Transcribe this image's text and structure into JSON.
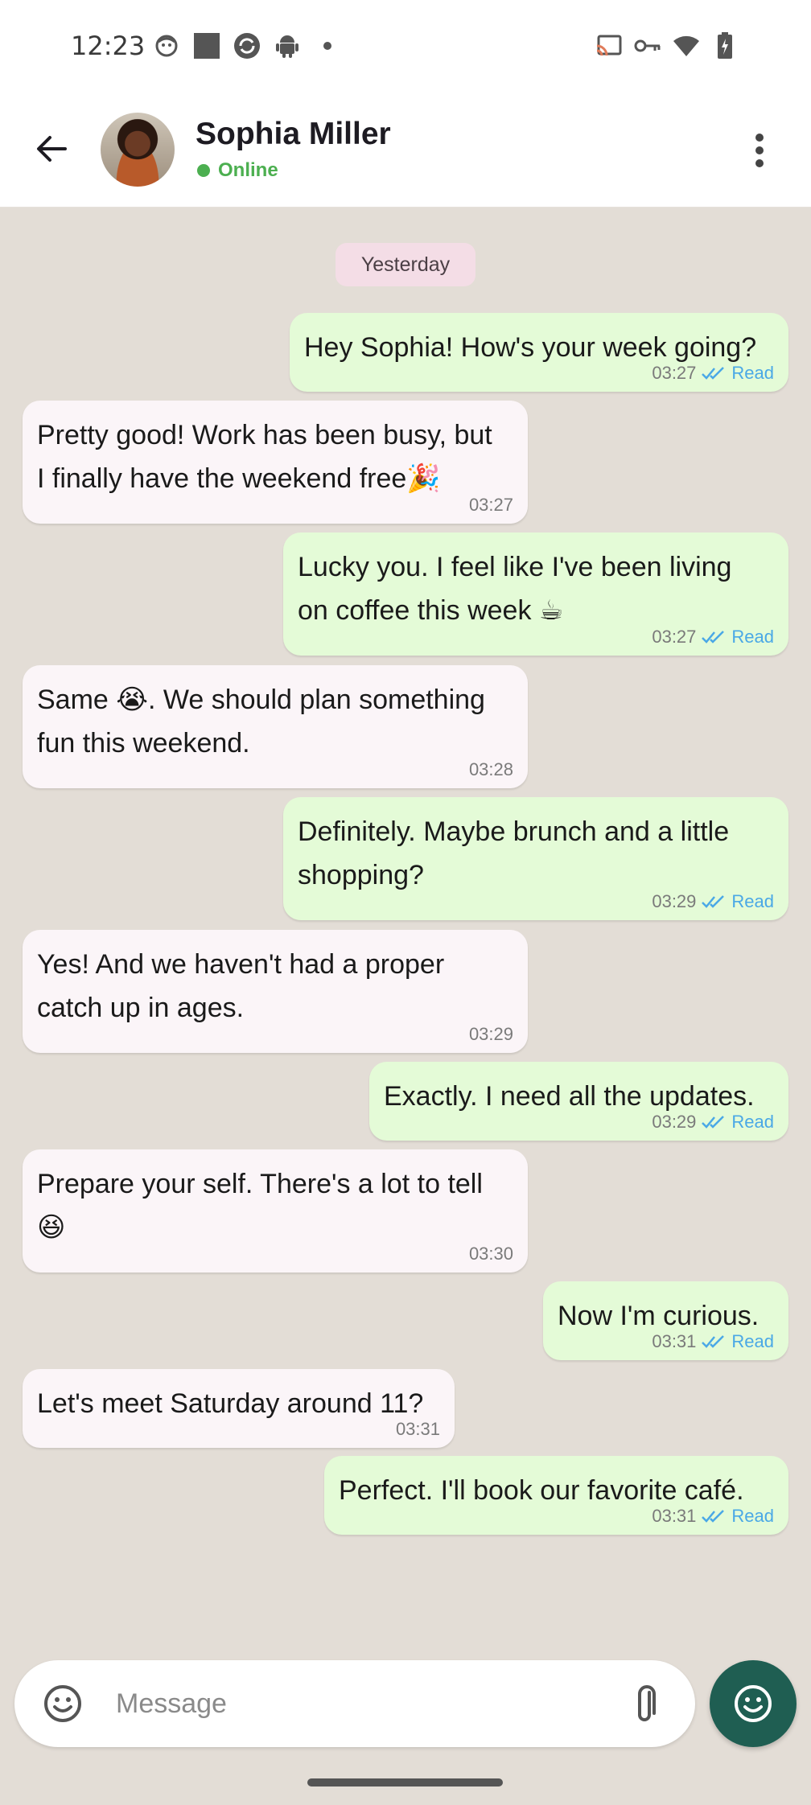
{
  "status_bar": {
    "time": "12:23",
    "left_icons": [
      "face-notification-icon",
      "square-notification-icon",
      "sync-notification-icon",
      "android-icon",
      "dot-icon"
    ],
    "right_icons": [
      "cast-icon",
      "key-icon",
      "wifi-icon",
      "battery-charging-icon"
    ]
  },
  "header": {
    "back_icon": "arrow-back-icon",
    "contact_name": "Sophia Miller",
    "status": "Online",
    "more_icon": "more-vert-icon"
  },
  "date_chip": "Yesterday",
  "messages": [
    {
      "dir": "out",
      "text": "Hey Sophia! How's your week going?",
      "time": "03:27",
      "status": "Read"
    },
    {
      "dir": "in",
      "text": "Pretty good! Work has been busy, but\nI finally have the weekend free🎉",
      "time": "03:27"
    },
    {
      "dir": "out",
      "text": "Lucky you. I feel like I've been living\non coffee this week ☕",
      "time": "03:27",
      "status": "Read"
    },
    {
      "dir": "in",
      "text": "Same 😭. We should plan something\nfun this weekend.",
      "time": "03:28"
    },
    {
      "dir": "out",
      "text": "Definitely. Maybe brunch and a little\nshopping?",
      "time": "03:29",
      "status": "Read"
    },
    {
      "dir": "in",
      "text": "Yes! And we haven't had a proper\ncatch up in ages.",
      "time": "03:29"
    },
    {
      "dir": "out",
      "text": "Exactly. I need all the updates.",
      "time": "03:29",
      "status": "Read"
    },
    {
      "dir": "in",
      "text": "Prepare your self. There's a lot to tell\n😆",
      "time": "03:30"
    },
    {
      "dir": "out",
      "text": "Now I'm curious.",
      "time": "03:31",
      "status": "Read"
    },
    {
      "dir": "in",
      "text": "Let's meet Saturday around 11?",
      "time": "03:31"
    },
    {
      "dir": "out",
      "text": "Perfect. I'll book our favorite café.",
      "time": "03:31",
      "status": "Read"
    }
  ],
  "input": {
    "placeholder": "Message",
    "emoji_icon": "emoji-icon",
    "attach_icon": "paperclip-icon",
    "send_icon": "emoji-icon"
  },
  "colors": {
    "chat_bg": "#e3ddd6",
    "outgoing_bubble": "#e4fbd7",
    "incoming_bubble": "#fbf5f8",
    "read_color": "#4aa8e6",
    "online_color": "#4caf50",
    "fab_color": "#1f5e52"
  }
}
